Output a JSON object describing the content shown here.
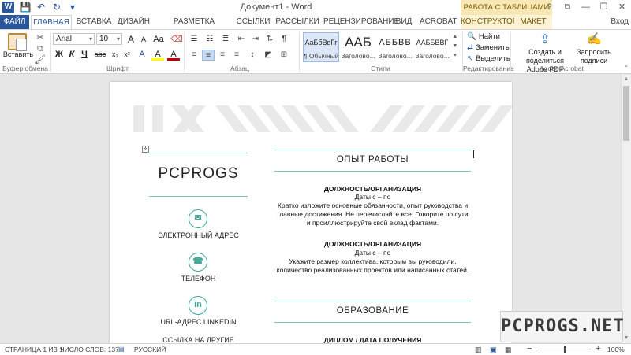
{
  "titlebar": {
    "app_logo": "W",
    "title": "Документ1 - Word",
    "context_group": "РАБОТА С ТАБЛИЦАМИ",
    "qat_icons": [
      "save-icon",
      "undo-icon",
      "redo-icon",
      "customize-icon"
    ],
    "window_controls": [
      "?",
      "⧉",
      "—",
      "❐",
      "✕"
    ]
  },
  "tabs": {
    "file": "ФАЙЛ",
    "items": [
      "ГЛАВНАЯ",
      "ВСТАВКА",
      "ДИЗАЙН",
      "РАЗМЕТКА СТРАНИЦЫ",
      "ССЫЛКИ",
      "РАССЫЛКИ",
      "РЕЦЕНЗИРОВАНИЕ",
      "ВИД",
      "ACROBAT"
    ],
    "context_items": [
      "КОНСТРУКТОР",
      "МАКЕТ"
    ],
    "active": "ГЛАВНАЯ",
    "user": "Вход"
  },
  "ribbon": {
    "clipboard": {
      "paste_label": "Вставить",
      "group_label": "Буфер обмена"
    },
    "font": {
      "font_name": "Arial",
      "font_size": "10",
      "grow": "A",
      "shrink": "A",
      "case": "Aa",
      "bold": "Ж",
      "italic": "К",
      "underline": "Ч",
      "strike": "abc",
      "subscript": "x₂",
      "superscript": "x²",
      "highlight": "A",
      "color": "A",
      "group_label": "Шрифт"
    },
    "paragraph": {
      "pilcrow": "¶",
      "group_label": "Абзац"
    },
    "styles": {
      "items": [
        {
          "sample": "АаБбВвГг",
          "name": "¶ Обычный"
        },
        {
          "sample": "ААБ",
          "name": "Заголово..."
        },
        {
          "sample": "АББВВ",
          "name": "Заголово..."
        },
        {
          "sample": "ААББВВГ",
          "name": "Заголово..."
        }
      ],
      "group_label": "Стили"
    },
    "editing": {
      "find": "Найти",
      "replace": "Заменить",
      "select": "Выделить",
      "group_label": "Редактирование"
    },
    "acrobat": {
      "create_line1": "Создать и поделиться",
      "create_line2": "Adobe PDF",
      "sign_line1": "Запросить",
      "sign_line2": "подписи",
      "group_label": "Adobe Acrobat"
    }
  },
  "document": {
    "name": "PCPROGS",
    "contacts": [
      {
        "icon": "email-icon",
        "glyph": "✉",
        "label": "ЭЛЕКТРОННЫЙ АДРЕС"
      },
      {
        "icon": "phone-icon",
        "glyph": "☎",
        "label": "ТЕЛЕФОН"
      },
      {
        "icon": "linkedin-icon",
        "glyph": "in",
        "label": "URL-АДРЕС LINKEDIN"
      },
      {
        "label": "ССЫЛКА НА ДРУГИЕ"
      }
    ],
    "experience_title": "ОПЫТ РАБОТЫ",
    "jobs": [
      {
        "title": "ДОЛЖНОСТЬ/ОРГАНИЗАЦИЯ",
        "dates": "Даты с – по",
        "lines": [
          "Кратко изложите основные обязанности, опыт руководства и",
          "главные достижения. Не перечисляйте все. Говорите по сути",
          "и проиллюстрируйте свой вклад фактами."
        ]
      },
      {
        "title": "ДОЛЖНОСТЬ/ОРГАНИЗАЦИЯ",
        "dates": "Даты с – по",
        "lines": [
          "Укажите размер коллектива, которым вы руководили,",
          "количество реализованных проектов или написанных статей."
        ]
      }
    ],
    "education_title": "ОБРАЗОВАНИЕ",
    "education_first": "ДИПЛОМ / ДАТА ПОЛУЧЕНИЯ"
  },
  "watermark": "PCPROGS.NET",
  "statusbar": {
    "page": "СТРАНИЦА 1 ИЗ 1",
    "words": "ЧИСЛО СЛОВ: 137",
    "language": "РУССКИЙ",
    "zoom_minus": "−",
    "zoom_plus": "+",
    "zoom": "100%"
  },
  "colors": {
    "word_blue": "#2b579a",
    "accent_teal": "#3fa796",
    "table_tools": "#f7e7b5"
  }
}
